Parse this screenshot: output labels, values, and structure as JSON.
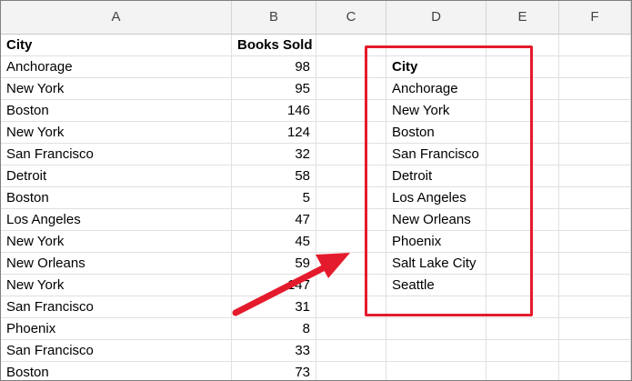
{
  "columns": [
    "A",
    "B",
    "C",
    "D",
    "E",
    "F"
  ],
  "colors": {
    "red_annotation": "#e41b2c",
    "header_bg": "#f3f3f3"
  },
  "table": {
    "headers": {
      "city": "City",
      "books_sold": "Books Sold"
    },
    "rows": [
      {
        "city": "Anchorage",
        "books": "98"
      },
      {
        "city": "New York",
        "books": "95"
      },
      {
        "city": "Boston",
        "books": "146"
      },
      {
        "city": "New York",
        "books": "124"
      },
      {
        "city": "San Francisco",
        "books": "32"
      },
      {
        "city": "Detroit",
        "books": "58"
      },
      {
        "city": "Boston",
        "books": "5"
      },
      {
        "city": "Los Angeles",
        "books": "47"
      },
      {
        "city": "New York",
        "books": "45"
      },
      {
        "city": "New Orleans",
        "books": "59"
      },
      {
        "city": "New York",
        "books": "147"
      },
      {
        "city": "San Francisco",
        "books": "31"
      },
      {
        "city": "Phoenix",
        "books": "8"
      },
      {
        "city": "San Francisco",
        "books": "33"
      },
      {
        "city": "Boston",
        "books": "73"
      }
    ]
  },
  "unique_list": {
    "header": "City",
    "items": [
      "Anchorage",
      "New York",
      "Boston",
      "San Francisco",
      "Detroit",
      "Los Angeles",
      "New Orleans",
      "Phoenix",
      "Salt Lake City",
      "Seattle"
    ]
  },
  "annotation": {
    "arrow_icon": "red-arrow-icon"
  }
}
